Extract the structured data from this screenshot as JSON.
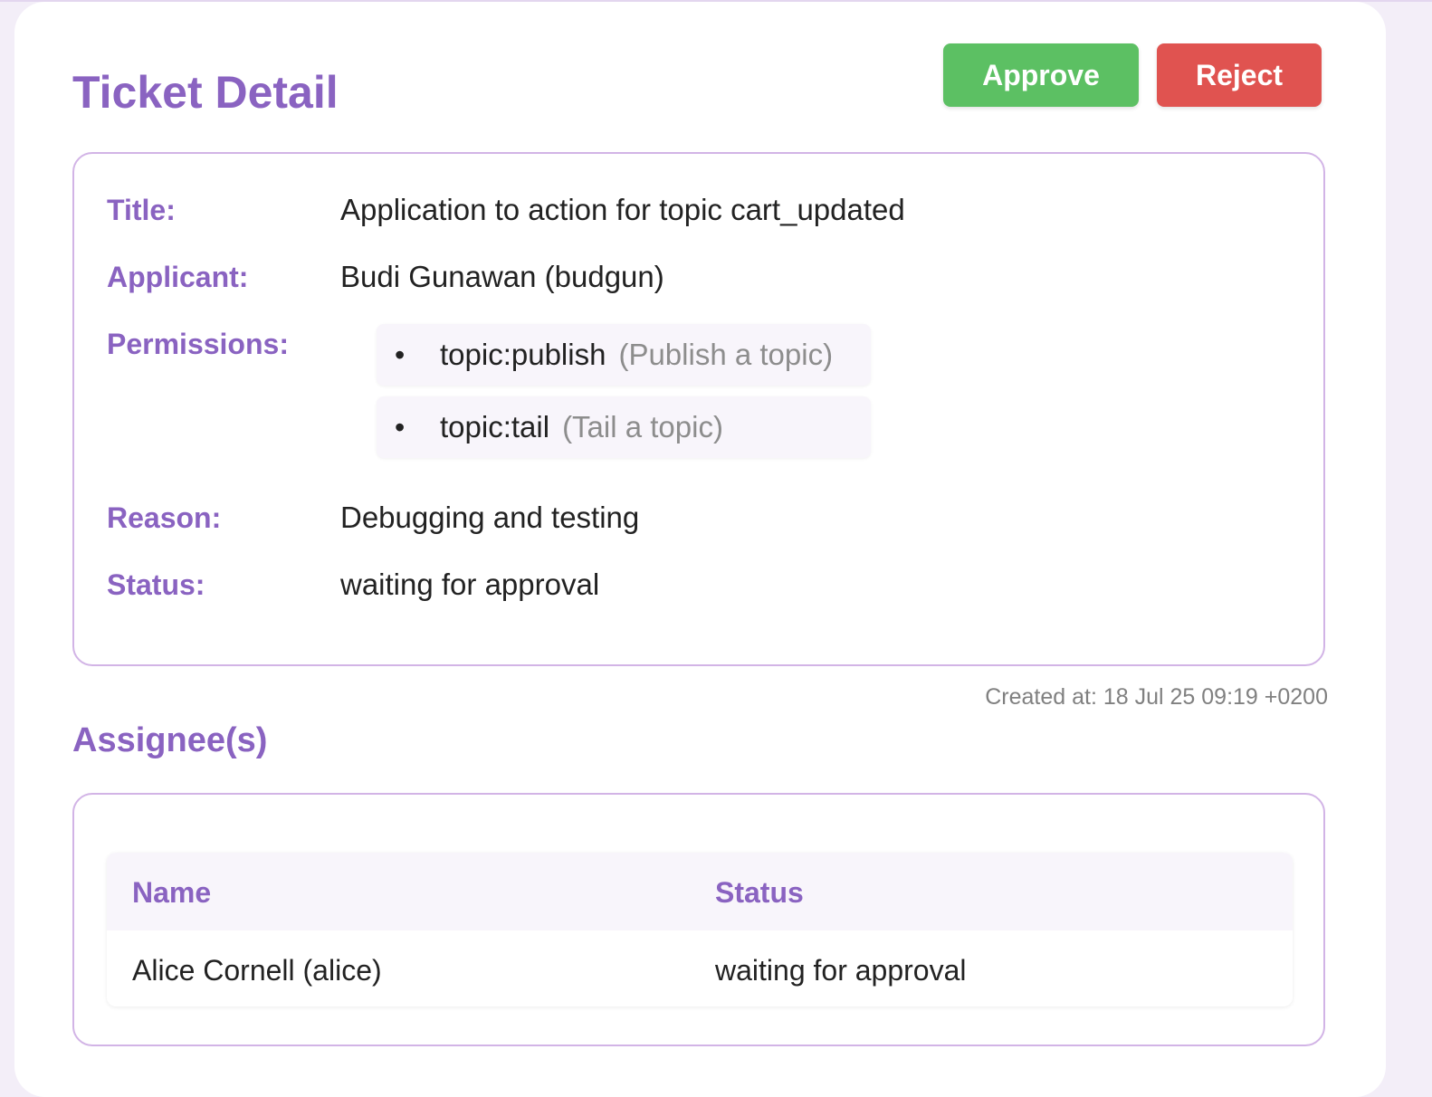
{
  "header": {
    "title": "Ticket Detail",
    "approve_label": "Approve",
    "reject_label": "Reject"
  },
  "details": {
    "title_label": "Title:",
    "title_value": "Application to action for topic cart_updated",
    "applicant_label": "Applicant:",
    "applicant_value": "Budi Gunawan (budgun)",
    "permissions_label": "Permissions:",
    "permissions": [
      {
        "bullet": "•",
        "name": "topic:publish",
        "description": "(Publish a topic)"
      },
      {
        "bullet": "•",
        "name": "topic:tail",
        "description": "(Tail a topic)"
      }
    ],
    "reason_label": "Reason:",
    "reason_value": "Debugging and testing",
    "status_label": "Status:",
    "status_value": "waiting for approval"
  },
  "created_at": "Created at: 18 Jul 25 09:19 +0200",
  "assignees": {
    "title": "Assignee(s)",
    "columns": [
      "Name",
      "Status"
    ],
    "rows": [
      {
        "name": "Alice Cornell (alice)",
        "status": "waiting for approval"
      }
    ]
  },
  "colors": {
    "accent": "#8a63c1",
    "approve": "#5cc063",
    "reject": "#e05350",
    "border": "#d2b4e6"
  }
}
